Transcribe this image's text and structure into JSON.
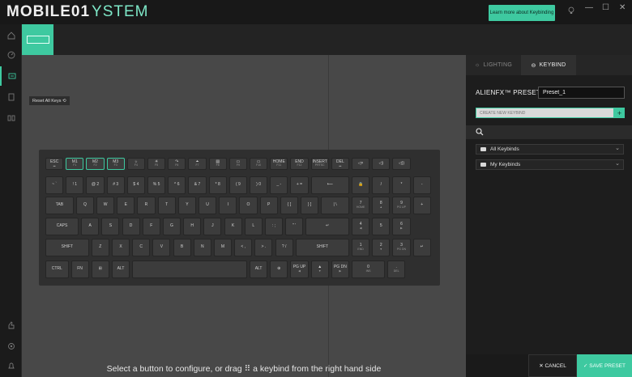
{
  "app": {
    "logo_text": "MOBILE01",
    "logo_suffix": "YSTEM",
    "learn_more": "Learn more about Keybinding",
    "accent": "#3ec9a0"
  },
  "window_controls": [
    "—",
    "☐",
    "✕"
  ],
  "sidebar": {
    "items": [
      "home-icon",
      "gauge-icon",
      "fx-icon",
      "device-icon",
      "library-icon",
      "thumb-icon",
      "settings-icon",
      "bell-icon"
    ]
  },
  "canvas": {
    "reset_label": "Reset All Keys ⟲",
    "hint": "Select a button to configure, or drag ⠿ a keybind from the right hand side"
  },
  "keyboard": {
    "rows": [
      [
        {
          "main": "ESC",
          "sub": "▂"
        },
        {
          "main": "M1",
          "sub": "F1",
          "hl": true
        },
        {
          "main": "M2",
          "sub": "F2",
          "hl": true
        },
        {
          "main": "M3",
          "sub": "F3",
          "hl": true
        },
        {
          "main": "☼",
          "sub": "F4"
        },
        {
          "main": "☀",
          "sub": "F5"
        },
        {
          "main": "↷",
          "sub": "F6"
        },
        {
          "main": "⏶",
          "sub": "F7"
        },
        {
          "main": "▤",
          "sub": "F8"
        },
        {
          "main": "▭",
          "sub": "F9"
        },
        {
          "main": "▭",
          "sub": "F10"
        },
        {
          "main": "HOME",
          "sub": "F11"
        },
        {
          "main": "END",
          "sub": "F12"
        },
        {
          "main": "INSERT",
          "sub": "PRTSC"
        },
        {
          "main": "DEL",
          "sub": "▂"
        },
        {
          "main": "◁×",
          "sub": ""
        },
        {
          "main": "◁)",
          "sub": ""
        },
        {
          "main": "◁))",
          "sub": ""
        }
      ],
      [
        {
          "main": "~ `"
        },
        {
          "main": "! 1"
        },
        {
          "main": "@ 2"
        },
        {
          "main": "# 3"
        },
        {
          "main": "$ 4"
        },
        {
          "main": "% 5"
        },
        {
          "main": "^ 6"
        },
        {
          "main": "& 7"
        },
        {
          "main": "* 8"
        },
        {
          "main": "( 9"
        },
        {
          "main": ") 0"
        },
        {
          "main": "_ -"
        },
        {
          "main": "+ ="
        },
        {
          "main": "⟵"
        },
        {
          "main": "🔒"
        },
        {
          "main": "/"
        },
        {
          "main": "*"
        },
        {
          "main": "-"
        }
      ],
      [
        {
          "main": "TAB"
        },
        {
          "main": "Q"
        },
        {
          "main": "W"
        },
        {
          "main": "E"
        },
        {
          "main": "R"
        },
        {
          "main": "T"
        },
        {
          "main": "Y"
        },
        {
          "main": "U"
        },
        {
          "main": "I"
        },
        {
          "main": "O"
        },
        {
          "main": "P"
        },
        {
          "main": "{ ["
        },
        {
          "main": "} ]"
        },
        {
          "main": "| \\"
        },
        {
          "main": "7",
          "sub": "HOME"
        },
        {
          "main": "8",
          "sub": "▲"
        },
        {
          "main": "9",
          "sub": "PG UP"
        },
        {
          "main": "+"
        }
      ],
      [
        {
          "main": "CAPS"
        },
        {
          "main": "A"
        },
        {
          "main": "S"
        },
        {
          "main": "D"
        },
        {
          "main": "F"
        },
        {
          "main": "G"
        },
        {
          "main": "H"
        },
        {
          "main": "J"
        },
        {
          "main": "K"
        },
        {
          "main": "L"
        },
        {
          "main": ": ;"
        },
        {
          "main": "\" '"
        },
        {
          "main": "↵"
        },
        {
          "main": "4",
          "sub": "◀"
        },
        {
          "main": "5",
          "sub": ""
        },
        {
          "main": "6",
          "sub": "▶"
        }
      ],
      [
        {
          "main": "SHIFT"
        },
        {
          "main": "Z"
        },
        {
          "main": "X"
        },
        {
          "main": "C"
        },
        {
          "main": "V"
        },
        {
          "main": "B"
        },
        {
          "main": "N"
        },
        {
          "main": "M"
        },
        {
          "main": "< ,"
        },
        {
          "main": "> ."
        },
        {
          "main": "? /"
        },
        {
          "main": "SHIFT"
        },
        {
          "main": "1",
          "sub": "END"
        },
        {
          "main": "2",
          "sub": "▼"
        },
        {
          "main": "3",
          "sub": "PG DN"
        },
        {
          "main": "↵"
        }
      ],
      [
        {
          "main": "CTRL"
        },
        {
          "main": "FN"
        },
        {
          "main": "⊞"
        },
        {
          "main": "ALT"
        },
        {
          "main": ""
        },
        {
          "main": "ALT"
        },
        {
          "main": "⊕"
        },
        {
          "main": "PG UP",
          "sub": "◀"
        },
        {
          "main": "▲",
          "sub": "▼"
        },
        {
          "main": "PG DN",
          "sub": "▶"
        },
        {
          "main": "0",
          "sub": "INS"
        },
        {
          "main": ".",
          "sub": "DEL"
        }
      ]
    ]
  },
  "panel": {
    "tab_lighting": "LIGHTING",
    "tab_keybind": "KEYBIND",
    "preset_label": "ALIENFX™ PRESET",
    "preset_value": "Preset_1",
    "create_placeholder": "CREATE NEW KEYBIND",
    "create_add": "+",
    "folders": [
      {
        "label": "All Keybinds"
      },
      {
        "label": "My Keybinds"
      }
    ],
    "cancel": "✕ CANCEL",
    "save": "✓ SAVE PRESET"
  }
}
